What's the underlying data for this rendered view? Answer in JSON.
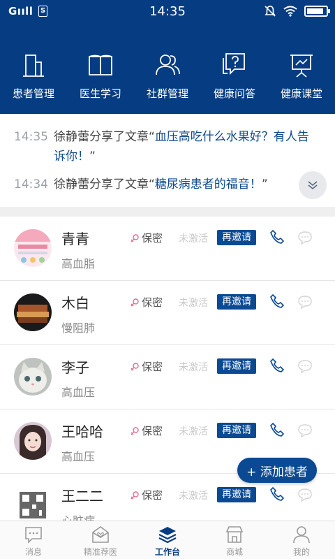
{
  "status_bar": {
    "carrier": "Gııll",
    "sim_label": "S",
    "time": "14:35",
    "battery_level": 0.9
  },
  "header": {
    "items": [
      {
        "label": "患者管理",
        "icon": "building-icon"
      },
      {
        "label": "医生学习",
        "icon": "book-icon"
      },
      {
        "label": "社群管理",
        "icon": "group-icon"
      },
      {
        "label": "健康问答",
        "icon": "question-bubble-icon"
      },
      {
        "label": "健康课堂",
        "icon": "presentation-board-icon"
      }
    ]
  },
  "feed": [
    {
      "time": "14:35",
      "text": "徐静蕾分享了文章“",
      "title": "血压高吃什么水果好？有人告诉你！",
      "close": "”"
    },
    {
      "time": "14:34",
      "text": "徐静蕾分享了文章“",
      "title": "糖尿病患者的福音！",
      "close": "”"
    }
  ],
  "patients": [
    {
      "name": "青青",
      "condition": "高血脂",
      "gender": "保密",
      "status": "未激活",
      "invite": "再邀请"
    },
    {
      "name": "木白",
      "condition": "慢阻肺",
      "gender": "保密",
      "status": "未激活",
      "invite": "再邀请"
    },
    {
      "name": "李子",
      "condition": "高血压",
      "gender": "保密",
      "status": "未激活",
      "invite": "再邀请"
    },
    {
      "name": "王哈哈",
      "condition": "高血压",
      "gender": "保密",
      "status": "未激活",
      "invite": "再邀请"
    },
    {
      "name": "王二二",
      "condition": "心脏病",
      "gender": "保密",
      "status": "未激活",
      "invite": "再邀请"
    }
  ],
  "add_patient": "+ 添加患者",
  "tabs": [
    {
      "label": "消息",
      "icon": "message-icon"
    },
    {
      "label": "精准荐医",
      "icon": "heart-envelope-icon"
    },
    {
      "label": "工作台",
      "icon": "layers-icon",
      "active": true
    },
    {
      "label": "商城",
      "icon": "shop-icon"
    },
    {
      "label": "我的",
      "icon": "person-icon"
    }
  ],
  "colors": {
    "brand": "#063d82",
    "button": "#0b4a93",
    "link": "#0d4a8f",
    "muted": "#9aa0a6",
    "gender_icon": "#e96a8f"
  }
}
